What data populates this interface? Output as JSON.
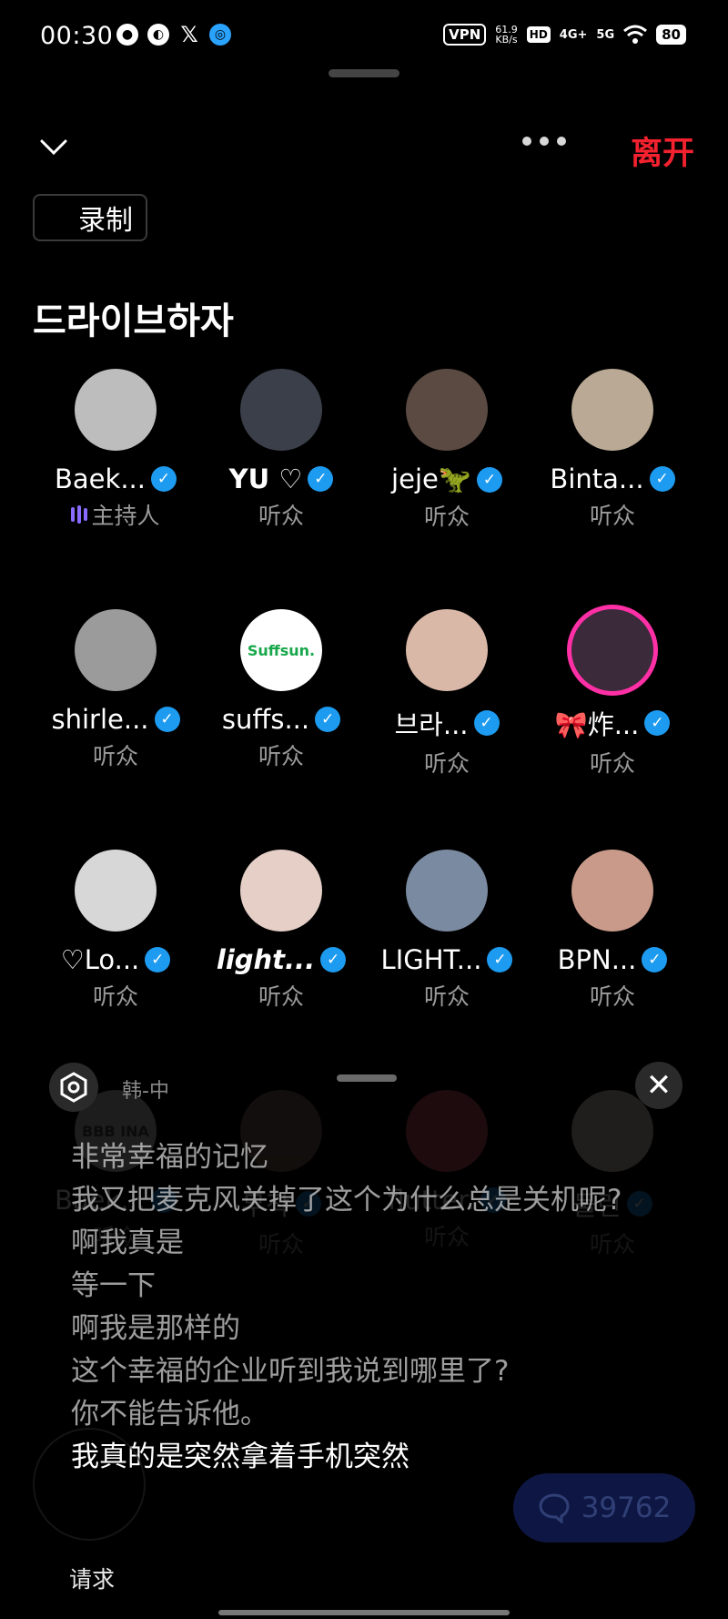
{
  "status": {
    "time": "00:30",
    "vpn": "VPN",
    "speed_value": "61.9",
    "speed_unit": "KB/s",
    "hd": "HD",
    "net4g": "4G+",
    "net5g": "5G",
    "battery": "80"
  },
  "header": {
    "leave_label": "离开",
    "record_label": "录制",
    "space_title": "드라이브하자"
  },
  "participants": [
    {
      "name": "Baek...",
      "role": "主持人",
      "verified": true,
      "host": true,
      "color": "#bdbdbd"
    },
    {
      "name": "YU ♡",
      "role": "听众",
      "verified": true,
      "color": "#3a3f4a"
    },
    {
      "name": "jeje🦖",
      "role": "听众",
      "verified": true,
      "color": "#5a4a42"
    },
    {
      "name": "Binta...",
      "role": "听众",
      "verified": true,
      "color": "#b9a995"
    },
    {
      "name": "shirle...",
      "role": "听众",
      "verified": true,
      "color": "#9b9b9b"
    },
    {
      "name": "suffs...",
      "role": "听众",
      "verified": true,
      "color": "#ffffff",
      "avatar_text": "Suffsun."
    },
    {
      "name": "브라...",
      "role": "听众",
      "verified": true,
      "color": "#d9b8a8"
    },
    {
      "name": "🎀炸...",
      "role": "听众",
      "verified": true,
      "color": "#3a2a3a",
      "ring": "#ff2fa6"
    },
    {
      "name": "♡Lo...",
      "role": "听众",
      "verified": true,
      "color": "#d7d7d7"
    },
    {
      "name": "light...",
      "role": "听众",
      "verified": true,
      "color": "#e5cfc7"
    },
    {
      "name": "LIGHT...",
      "role": "听众",
      "verified": true,
      "color": "#7a8aa0"
    },
    {
      "name": "BPN...",
      "role": "听众",
      "verified": true,
      "color": "#c99a8a"
    }
  ],
  "dim_participants": [
    {
      "name": "Baek...",
      "role": "听众",
      "color": "#dcdcdc",
      "avatar_text": "BBB INA"
    },
    {
      "name": "무작",
      "role": "听众",
      "color": "#8a7060"
    },
    {
      "name": "flutter.",
      "role": "听众",
      "color": "#e05a6a"
    },
    {
      "name": "물린",
      "role": "听众",
      "color": "#f0e6d6"
    }
  ],
  "translation": {
    "lang_label": "韩-中",
    "lines": [
      "非常幸福的记忆",
      "我又把麦克风关掉了这个为什么总是关机呢?",
      "啊我真是",
      "等一下",
      "啊我是那样的",
      "这个幸福的企业听到我说到哪里了?",
      "你不能告诉他。"
    ],
    "current_line": "我真的是突然拿着手机突然"
  },
  "footer": {
    "request_label": "请求",
    "comment_count": "39762"
  }
}
